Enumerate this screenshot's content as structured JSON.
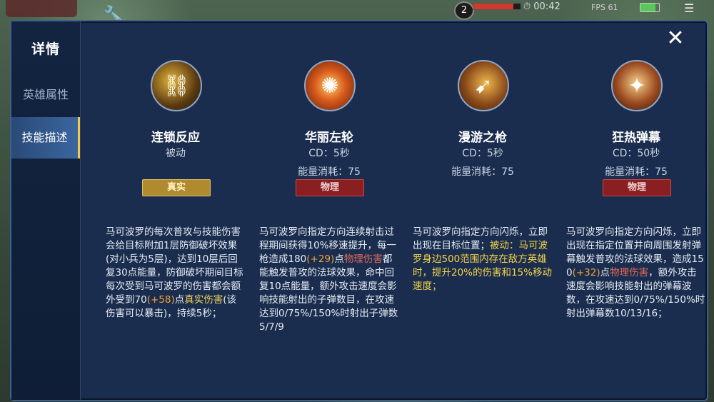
{
  "hud": {
    "level": "2",
    "hp_fraction": 0.85,
    "time": "00:42",
    "fps": "FPS 61",
    "battery_fraction": 0.8
  },
  "panel": {
    "title": "详情",
    "tabs": [
      {
        "label": "英雄属性",
        "active": false
      },
      {
        "label": "技能描述",
        "active": true
      }
    ],
    "close_icon": "close-icon"
  },
  "skills": [
    {
      "name": "连锁反应",
      "sub": "被动",
      "cost": "",
      "tag": "真实",
      "tag_type": "true",
      "desc": [
        {
          "t": "马可波罗的每次普攻与技能伤害会给目标附加1层防御破坏效果(对小兵为5层)，达到10层后回复30点能量，防御破坏期间目标每次受到马可波罗的伤害都会额外受到70",
          "c": ""
        },
        {
          "t": "(+58)",
          "c": "orange"
        },
        {
          "t": "点",
          "c": ""
        },
        {
          "t": "真实伤害",
          "c": "gold"
        },
        {
          "t": "(该伤害可以暴击)，持续5秒；",
          "c": ""
        }
      ]
    },
    {
      "name": "华丽左轮",
      "sub": "CD：5秒",
      "cost": "能量消耗：75",
      "tag": "物理",
      "tag_type": "phys",
      "desc": [
        {
          "t": "马可波罗向指定方向连续射击过程期间获得10%移速提升，每一枪造成180",
          "c": ""
        },
        {
          "t": "(+29)",
          "c": "orange"
        },
        {
          "t": "点",
          "c": ""
        },
        {
          "t": "物理伤害",
          "c": "red"
        },
        {
          "t": "都能触发普攻的法球效果，命中回复10点能量，额外攻击速度会影响技能射出的子弹数目，在攻速达到0/75%/150%时射出子弹数5/7/9",
          "c": ""
        }
      ]
    },
    {
      "name": "漫游之枪",
      "sub": "CD：5秒",
      "cost": "能量消耗：75",
      "tag": "",
      "tag_type": "",
      "desc": [
        {
          "t": "马可波罗向指定方向闪烁，立即出现在目标位置；",
          "c": ""
        },
        {
          "t": "被动：马可波罗身边500范围内存在敌方英雄时，提升20%的伤害和15%移动速度；",
          "c": "yellow"
        }
      ]
    },
    {
      "name": "狂热弹幕",
      "sub": "CD：50秒",
      "cost": "能量消耗：75",
      "tag": "物理",
      "tag_type": "phys",
      "desc": [
        {
          "t": "马可波罗向指定方向闪烁，立即出现在指定位置并向周围发射弹幕触发普攻的法球效果，造成150",
          "c": ""
        },
        {
          "t": "(+32)",
          "c": "orange"
        },
        {
          "t": "点",
          "c": ""
        },
        {
          "t": "物理伤害",
          "c": "red"
        },
        {
          "t": "，额外攻击速度会影响技能射出的弹幕波数，在攻速达到0/75%/150%时射出弹幕数10/13/16；",
          "c": ""
        }
      ]
    }
  ]
}
